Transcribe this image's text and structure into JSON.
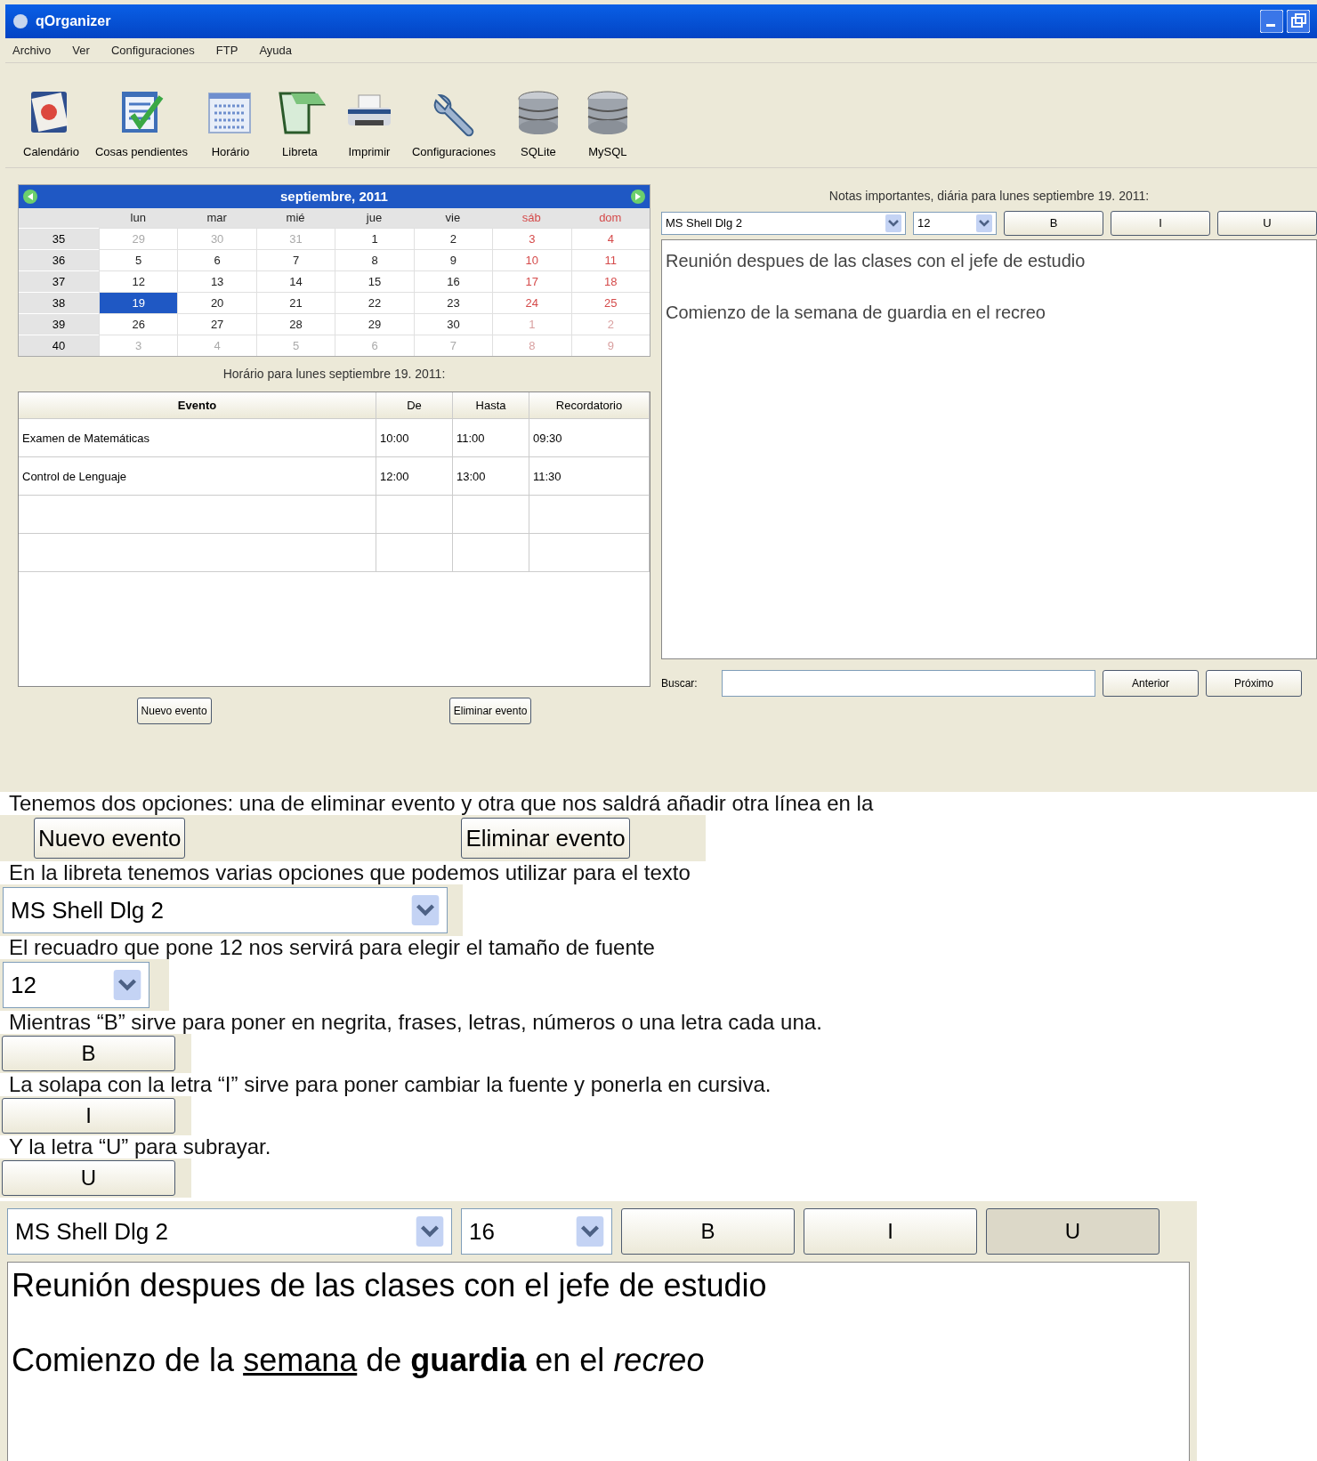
{
  "window": {
    "title": "qOrganizer"
  },
  "menu": [
    "Archivo",
    "Ver",
    "Configuraciones",
    "FTP",
    "Ayuda"
  ],
  "toolbar": [
    {
      "label": "Calendário",
      "kind": "calendar"
    },
    {
      "label": "Cosas pendientes",
      "kind": "todo"
    },
    {
      "label": "Horário",
      "kind": "schedule"
    },
    {
      "label": "Libreta",
      "kind": "notebook"
    },
    {
      "label": "Imprimir",
      "kind": "printer"
    },
    {
      "label": "Configuraciones",
      "kind": "wrench"
    },
    {
      "label": "SQLite",
      "kind": "database"
    },
    {
      "label": "MySQL",
      "kind": "database"
    }
  ],
  "calendar": {
    "month": "septiembre,  2011",
    "weekdays": [
      {
        "label": "lun",
        "weekend": false
      },
      {
        "label": "mar",
        "weekend": false
      },
      {
        "label": "mié",
        "weekend": false
      },
      {
        "label": "jue",
        "weekend": false
      },
      {
        "label": "vie",
        "weekend": false
      },
      {
        "label": "sáb",
        "weekend": true
      },
      {
        "label": "dom",
        "weekend": true
      }
    ],
    "weeks": [
      {
        "number": "35",
        "days": [
          {
            "day": "29",
            "other_month": true,
            "selected": false
          },
          {
            "day": "30",
            "other_month": true,
            "selected": false
          },
          {
            "day": "31",
            "other_month": true,
            "selected": false
          },
          {
            "day": "1",
            "other_month": false,
            "selected": false
          },
          {
            "day": "2",
            "other_month": false,
            "selected": false
          },
          {
            "day": "3",
            "other_month": false,
            "selected": false
          },
          {
            "day": "4",
            "other_month": false,
            "selected": false
          }
        ]
      },
      {
        "number": "36",
        "days": [
          {
            "day": "5",
            "other_month": false,
            "selected": false
          },
          {
            "day": "6",
            "other_month": false,
            "selected": false
          },
          {
            "day": "7",
            "other_month": false,
            "selected": false
          },
          {
            "day": "8",
            "other_month": false,
            "selected": false
          },
          {
            "day": "9",
            "other_month": false,
            "selected": false
          },
          {
            "day": "10",
            "other_month": false,
            "selected": false
          },
          {
            "day": "11",
            "other_month": false,
            "selected": false
          }
        ]
      },
      {
        "number": "37",
        "days": [
          {
            "day": "12",
            "other_month": false,
            "selected": false
          },
          {
            "day": "13",
            "other_month": false,
            "selected": false
          },
          {
            "day": "14",
            "other_month": false,
            "selected": false
          },
          {
            "day": "15",
            "other_month": false,
            "selected": false
          },
          {
            "day": "16",
            "other_month": false,
            "selected": false
          },
          {
            "day": "17",
            "other_month": false,
            "selected": false
          },
          {
            "day": "18",
            "other_month": false,
            "selected": false
          }
        ]
      },
      {
        "number": "38",
        "days": [
          {
            "day": "19",
            "other_month": false,
            "selected": true
          },
          {
            "day": "20",
            "other_month": false,
            "selected": false
          },
          {
            "day": "21",
            "other_month": false,
            "selected": false
          },
          {
            "day": "22",
            "other_month": false,
            "selected": false
          },
          {
            "day": "23",
            "other_month": false,
            "selected": false
          },
          {
            "day": "24",
            "other_month": false,
            "selected": false
          },
          {
            "day": "25",
            "other_month": false,
            "selected": false
          }
        ]
      },
      {
        "number": "39",
        "days": [
          {
            "day": "26",
            "other_month": false,
            "selected": false
          },
          {
            "day": "27",
            "other_month": false,
            "selected": false
          },
          {
            "day": "28",
            "other_month": false,
            "selected": false
          },
          {
            "day": "29",
            "other_month": false,
            "selected": false
          },
          {
            "day": "30",
            "other_month": false,
            "selected": false
          },
          {
            "day": "1",
            "other_month": true,
            "selected": false
          },
          {
            "day": "2",
            "other_month": true,
            "selected": false
          }
        ]
      },
      {
        "number": "40",
        "days": [
          {
            "day": "3",
            "other_month": true,
            "selected": false
          },
          {
            "day": "4",
            "other_month": true,
            "selected": false
          },
          {
            "day": "5",
            "other_month": true,
            "selected": false
          },
          {
            "day": "6",
            "other_month": true,
            "selected": false
          },
          {
            "day": "7",
            "other_month": true,
            "selected": false
          },
          {
            "day": "8",
            "other_month": true,
            "selected": false
          },
          {
            "day": "9",
            "other_month": true,
            "selected": false
          }
        ]
      }
    ]
  },
  "schedule": {
    "title": "Horário para lunes septiembre 19. 2011:",
    "columns": [
      "Evento",
      "De",
      "Hasta",
      "Recordatorio"
    ],
    "rows": [
      [
        "Examen de Matemáticas",
        "10:00",
        "11:00",
        "09:30"
      ],
      [
        "Control de Lenguaje",
        "12:00",
        "13:00",
        "11:30"
      ]
    ],
    "buttons": [
      "Nuevo evento",
      "Eliminar evento"
    ]
  },
  "notes": {
    "title": "Notas importantes, diária para lunes septiembre 19. 2011:",
    "font": "MS Shell Dlg 2",
    "size": "12",
    "format_buttons": [
      "B",
      "I",
      "U"
    ],
    "lines": [
      "Reunión despues de las clases con el jefe de estudio",
      "Comienzo de la semana de guardia en el recreo"
    ],
    "search_label": "Buscar:",
    "nav_buttons": [
      "Anterior",
      "Próximo"
    ]
  },
  "article": [
    {
      "kind": "text",
      "text": "Tenemos dos opciones: una de eliminar evento y otra que nos saldrá añadir otra línea en la"
    },
    {
      "kind": "buttons",
      "labels": [
        "Nuevo evento",
        "Eliminar evento"
      ]
    },
    {
      "kind": "text",
      "text": "En la libreta tenemos varias opciones que podemos utilizar para el texto"
    },
    {
      "kind": "combo",
      "value": "MS Shell Dlg 2"
    },
    {
      "kind": "text",
      "text": "El recuadro que pone 12 nos servirá para elegir el tamaño de fuente"
    },
    {
      "kind": "size",
      "value": "12"
    },
    {
      "kind": "text",
      "text": "Mientras “B” sirve para poner en negrita, frases, letras, números o una letra cada una."
    },
    {
      "kind": "button",
      "label": "B"
    },
    {
      "kind": "text",
      "text": "La solapa con la letra “I” sirve para poner cambiar la fuente y ponerla en cursiva."
    },
    {
      "kind": "button",
      "label": "I"
    },
    {
      "kind": "text",
      "text": "Y la letra “U” para subrayar."
    },
    {
      "kind": "button",
      "label": "U"
    }
  ],
  "example": {
    "font": "MS Shell Dlg 2",
    "size": "16",
    "format_buttons": [
      {
        "label": "B",
        "pressed": false
      },
      {
        "label": "I",
        "pressed": false
      },
      {
        "label": "U",
        "pressed": true
      }
    ],
    "lines": [
      [
        {
          "text": "Reunión despues de las clases con el jefe de estudio",
          "kind": "plain"
        }
      ],
      [
        {
          "text": "Comienzo de la ",
          "kind": "plain"
        },
        {
          "text": "semana",
          "kind": "underline"
        },
        {
          "text": " de ",
          "kind": "plain"
        },
        {
          "text": "guardia",
          "kind": "bold"
        },
        {
          "text": " en el ",
          "kind": "plain"
        },
        {
          "text": "recreo",
          "kind": "italic"
        }
      ]
    ]
  }
}
